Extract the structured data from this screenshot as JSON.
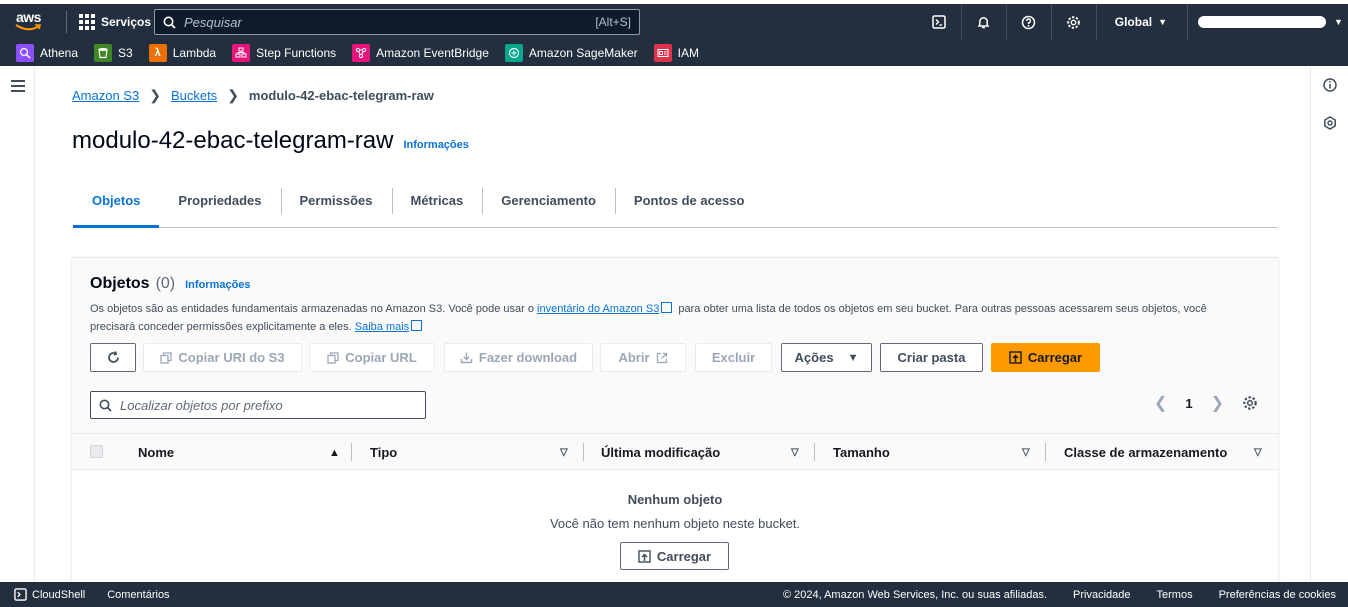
{
  "topnav": {
    "logo": "aws",
    "services": "Serviços",
    "search_placeholder": "Pesquisar",
    "search_shortcut": "[Alt+S]",
    "region": "Global"
  },
  "favorites": [
    {
      "label": "Athena",
      "color": "#8c4fff"
    },
    {
      "label": "S3",
      "color": "#3f8624"
    },
    {
      "label": "Lambda",
      "color": "#ed7100"
    },
    {
      "label": "Step Functions",
      "color": "#e7157b"
    },
    {
      "label": "Amazon EventBridge",
      "color": "#e7157b"
    },
    {
      "label": "Amazon SageMaker",
      "color": "#01a88d"
    },
    {
      "label": "IAM",
      "color": "#dd344c"
    }
  ],
  "breadcrumb": {
    "root": "Amazon S3",
    "buckets": "Buckets",
    "current": "modulo-42-ebac-telegram-raw"
  },
  "page": {
    "title": "modulo-42-ebac-telegram-raw",
    "info": "Informações"
  },
  "tabs": [
    "Objetos",
    "Propriedades",
    "Permissões",
    "Métricas",
    "Gerenciamento",
    "Pontos de acesso"
  ],
  "objects": {
    "heading": "Objetos",
    "count": "(0)",
    "info": "Informações",
    "desc_1": "Os objetos são as entidades fundamentais armazenadas no Amazon S3. Você pode usar o",
    "desc_link_1": "inventário do Amazon S3",
    "desc_2": "para obter uma lista de todos os objetos em seu bucket. Para outras pessoas acessarem seus objetos, você precisará conceder permissões explicitamente a eles.",
    "desc_link_2": "Saiba mais",
    "buttons": {
      "copy_uri": "Copiar URI do S3",
      "copy_url": "Copiar URL",
      "download": "Fazer download",
      "open": "Abrir",
      "delete": "Excluir",
      "actions": "Ações",
      "create_folder": "Criar pasta",
      "upload": "Carregar"
    },
    "prefix_placeholder": "Localizar objetos por prefixo",
    "page": "1",
    "columns": [
      "Nome",
      "Tipo",
      "Última modificação",
      "Tamanho",
      "Classe de armazenamento"
    ],
    "empty_title": "Nenhum objeto",
    "empty_desc": "Você não tem nenhum objeto neste bucket.",
    "empty_upload": "Carregar"
  },
  "footer": {
    "cloudshell": "CloudShell",
    "feedback": "Comentários",
    "copyright": "© 2024, Amazon Web Services, Inc. ou suas afiliadas.",
    "privacy": "Privacidade",
    "terms": "Termos",
    "cookies": "Preferências de cookies"
  }
}
